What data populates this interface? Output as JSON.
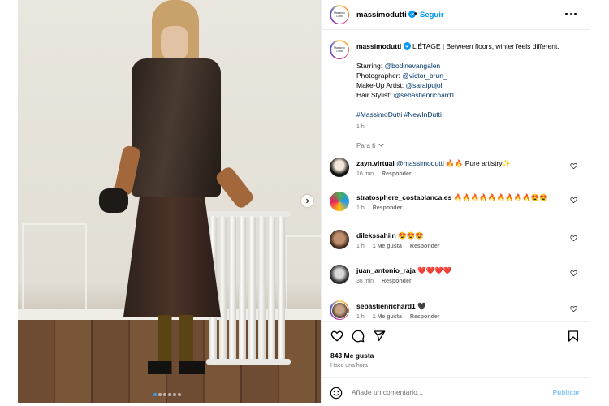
{
  "header": {
    "avatar_text": "Massimo Dutti",
    "username": "massimodutti",
    "separator": "•",
    "follow_label": "Seguir"
  },
  "caption": {
    "username": "massimodutti",
    "title": "L'ÉTAGE | Between floors, winter feels different.",
    "starring_label": "Starring:",
    "starring_handle": "@bodinevangalen",
    "photographer_label": "Photographer:",
    "photographer_handle": "@victor_brun_",
    "makeup_label": "Make-Up Artist:",
    "makeup_handle": "@saraipujol",
    "hair_label": "Hair Stylist:",
    "hair_handle": "@sebastienrichard1",
    "hashtags": "#MassimoDutti #NewInDutti",
    "time": "1 h"
  },
  "for_you_label": "Para ti",
  "comments": [
    {
      "user": "zayn.virtual",
      "mention": "@massimodutti",
      "text": "🔥🔥 Pure artistry✨",
      "time": "16 min",
      "likes": "",
      "reply": "Responder"
    },
    {
      "user": "stratosphere_costablanca.es",
      "mention": "",
      "text": "🔥🔥🔥🔥🔥🔥🔥🔥🔥😍😍",
      "time": "1 h",
      "likes": "",
      "reply": "Responder"
    },
    {
      "user": "dilekssahiin",
      "mention": "",
      "text": "😍😍😍",
      "time": "1 h",
      "likes": "1 Me gusta",
      "reply": "Responder"
    },
    {
      "user": "juan_antonio_raja",
      "mention": "",
      "text": "❤️❤️❤️❤️",
      "time": "38 min",
      "likes": "",
      "reply": "Responder"
    },
    {
      "user": "sebastienrichard1",
      "mention": "",
      "text": "🖤",
      "time": "1 h",
      "likes": "1 Me gusta",
      "reply": "Responder"
    }
  ],
  "stats": {
    "likes": "843 Me gusta",
    "time_ago": "Hace una hora"
  },
  "comment_box": {
    "placeholder": "Añade un comentario...",
    "publish_label": "Publicar"
  },
  "carousel": {
    "slide_count": 6,
    "active_index": 0
  },
  "colors": {
    "link": "#00376b",
    "follow": "#0095f6",
    "publish_disabled": "#85c5f7",
    "muted": "#737373"
  }
}
